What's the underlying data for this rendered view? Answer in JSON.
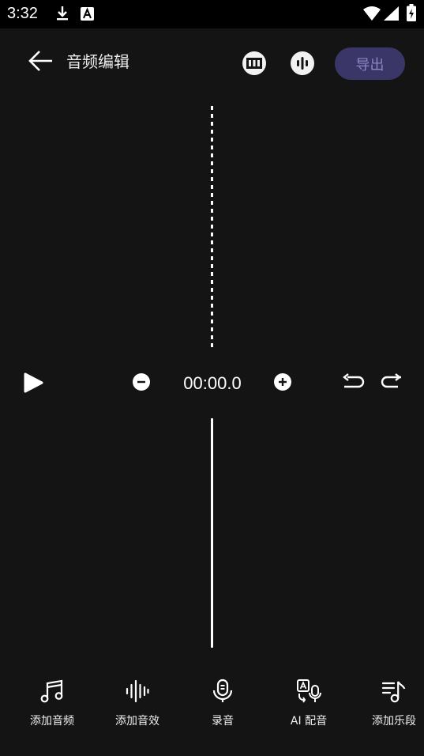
{
  "status_bar": {
    "time": "3:32"
  },
  "app_bar": {
    "title": "音频编辑",
    "export_label": "导出"
  },
  "controls": {
    "timecode": "00:00.0"
  },
  "toolbar": {
    "items": [
      {
        "label": "添加音频",
        "icon": "music-note-icon"
      },
      {
        "label": "添加音效",
        "icon": "sound-wave-icon"
      },
      {
        "label": "录音",
        "icon": "microphone-icon"
      },
      {
        "label": "AI 配音",
        "icon": "ai-voice-icon"
      },
      {
        "label": "添加乐段",
        "icon": "music-list-icon"
      }
    ]
  },
  "colors": {
    "background": "#141414",
    "export_bg": "#3a3668",
    "export_text": "#8c86c6"
  }
}
